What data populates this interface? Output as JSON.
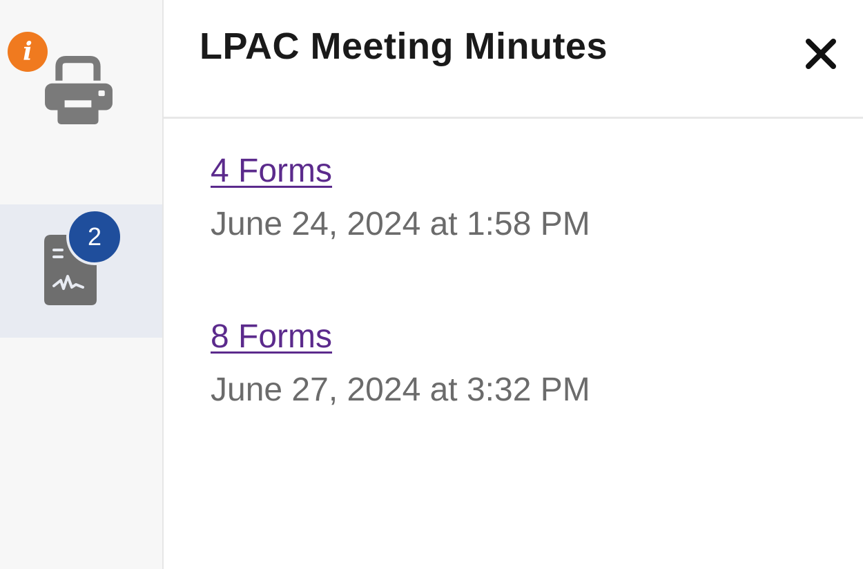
{
  "sidebar": {
    "print": {
      "icon": "printer-icon",
      "info_badge_icon": "info-icon",
      "info_badge_glyph": "i",
      "info_badge_color": "#f07a1f"
    },
    "forms": {
      "icon": "signed-document-icon",
      "badge_count": "2",
      "badge_color": "#1f4e9c",
      "selected": true
    }
  },
  "panel": {
    "title": "LPAC Meeting Minutes",
    "close_icon": "close-icon",
    "entries": [
      {
        "link": "4 Forms",
        "date": "June 24, 2024 at 1:58 PM"
      },
      {
        "link": "8 Forms",
        "date": "June 27, 2024 at 3:32 PM"
      }
    ],
    "link_color": "#5b2a8c"
  }
}
